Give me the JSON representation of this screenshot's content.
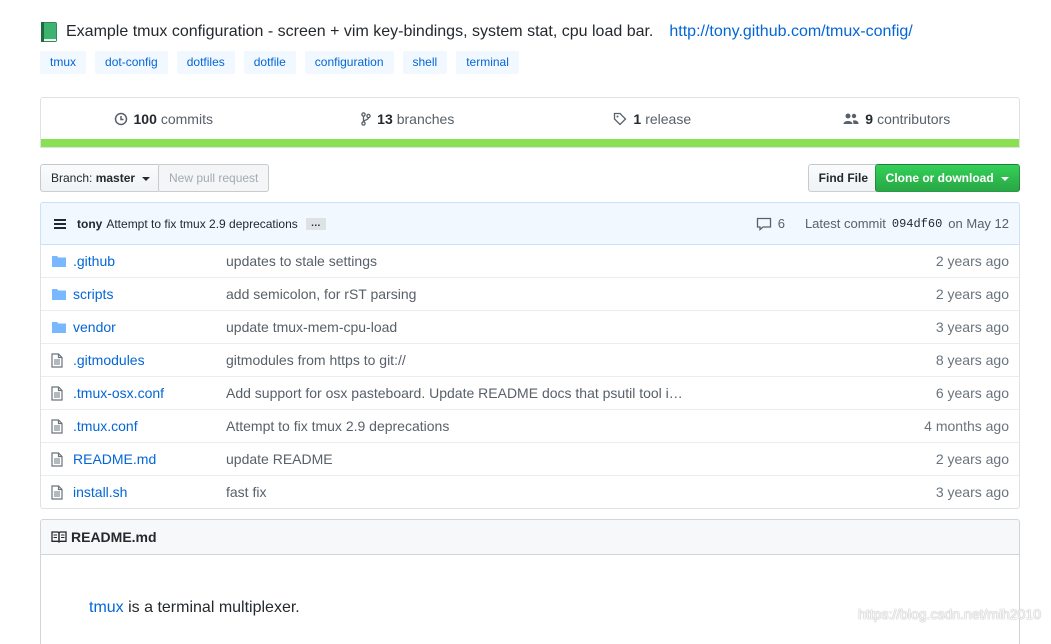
{
  "repo": {
    "description": "Example tmux configuration - screen + vim key-bindings, system stat, cpu load bar.",
    "homepage": "http://tony.github.com/tmux-config/",
    "topics": [
      "tmux",
      "dot-config",
      "dotfiles",
      "dotfile",
      "configuration",
      "shell",
      "terminal"
    ]
  },
  "summary": {
    "commits_num": "100",
    "commits_label": "commits",
    "branches_num": "13",
    "branches_label": "branches",
    "releases_num": "1",
    "releases_label": "release",
    "contributors_num": "9",
    "contributors_label": "contributors",
    "language_color": "#89e051"
  },
  "toolbar": {
    "branch_prefix": "Branch:",
    "branch_name": "master",
    "new_pr": "New pull request",
    "find_file": "Find File",
    "clone": "Clone or download"
  },
  "latest_commit": {
    "author": "tony",
    "message": "Attempt to fix tmux 2.9 deprecations",
    "ellipsis": "…",
    "comments": "6",
    "label": "Latest commit",
    "sha": "094df60",
    "date": "on May 12"
  },
  "files": [
    {
      "name": ".github",
      "type": "dir",
      "message": "updates to stale settings",
      "age": "2 years ago"
    },
    {
      "name": "scripts",
      "type": "dir",
      "message": "add semicolon, for rST parsing",
      "age": "2 years ago"
    },
    {
      "name": "vendor",
      "type": "dir",
      "message": "update tmux-mem-cpu-load",
      "age": "3 years ago"
    },
    {
      "name": ".gitmodules",
      "type": "file",
      "message": "gitmodules from https to git://",
      "age": "8 years ago"
    },
    {
      "name": ".tmux-osx.conf",
      "type": "file",
      "message": "Add support for osx pasteboard. Update README docs that psutil tool i…",
      "age": "6 years ago"
    },
    {
      "name": ".tmux.conf",
      "type": "file",
      "message": "Attempt to fix tmux 2.9 deprecations",
      "age": "4 months ago"
    },
    {
      "name": "README.md",
      "type": "file",
      "message": "update README",
      "age": "2 years ago"
    },
    {
      "name": "install.sh",
      "type": "file",
      "message": "fast fix",
      "age": "3 years ago"
    }
  ],
  "readme": {
    "title": "README.md",
    "link_text": "tmux",
    "text_after": " is a terminal multiplexer."
  },
  "watermark": "https://blog.csdn.net/mih2010"
}
